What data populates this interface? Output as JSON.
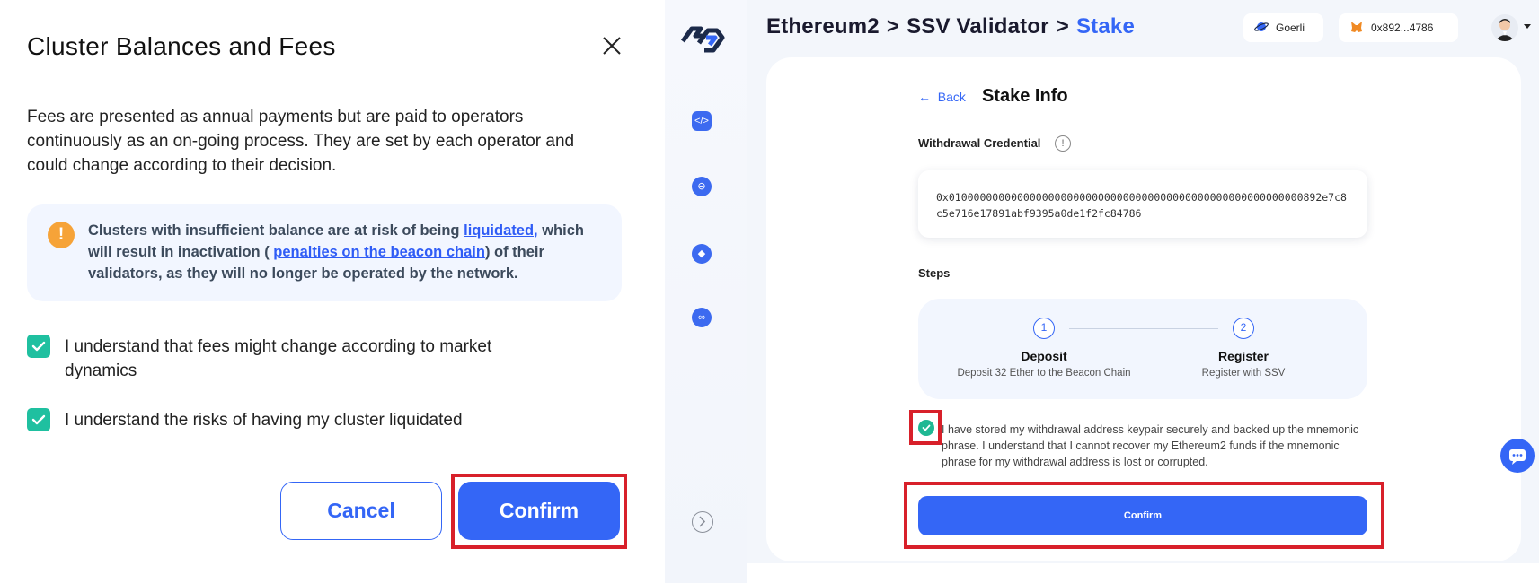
{
  "modal": {
    "title": "Cluster Balances and Fees",
    "description": "Fees are presented as annual payments but are paid to operators continuously as an on-going process. They are set by each operator and could change according to their decision.",
    "warning": {
      "part1": "Clusters with insufficient balance are at risk of being ",
      "link1": "liquidated,",
      "part2": " which will result in inactivation ( ",
      "link2": "penalties on the beacon chain",
      "part3": ") of their validators, as they will no longer be operated by the network."
    },
    "checks": [
      {
        "label": "I understand that fees might change according to market dynamics",
        "checked": true
      },
      {
        "label": "I understand the risks of having my cluster liquidated",
        "checked": true
      }
    ],
    "cancel_label": "Cancel",
    "confirm_label": "Confirm"
  },
  "header": {
    "breadcrumb": [
      "Ethereum2",
      "SSV Validator",
      "Stake"
    ],
    "separator": ">",
    "network": "Goerli",
    "wallet": "0x892...4786"
  },
  "stake": {
    "back_label": "Back",
    "title": "Stake Info",
    "withdrawal_label": "Withdrawal Credential",
    "withdrawal_value": "0x010000000000000000000000000000000000000000000000000000000892e7c8c5e716e17891abf9395a0de1f2fc84786",
    "steps_label": "Steps",
    "steps": [
      {
        "num": "1",
        "name": "Deposit",
        "desc": "Deposit 32 Ether to the Beacon Chain"
      },
      {
        "num": "2",
        "name": "Register",
        "desc": "Register with SSV"
      }
    ],
    "agreement": "I have stored my withdrawal address keypair securely and backed up the mnemonic phrase. I understand that I cannot recover my Ethereum2 funds if the mnemonic phrase for my withdrawal address is lost or corrupted.",
    "confirm_label": "Confirm"
  },
  "colors": {
    "accent": "#3466f6",
    "check_green": "#1fc0a0",
    "warning_orange": "#f6a338",
    "highlight_red": "#d8202a"
  }
}
